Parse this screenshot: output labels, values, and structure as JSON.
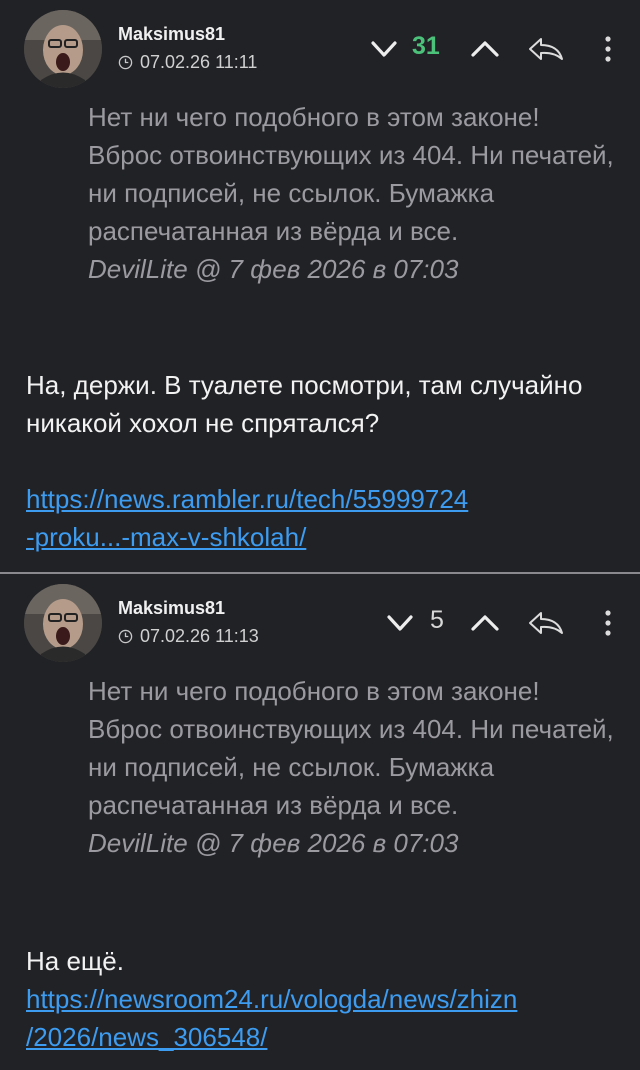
{
  "comments": [
    {
      "username": "Maksimus81",
      "datetime": "07.02.26 11:11",
      "score": "31",
      "score_color": "#4cc17a",
      "quote": {
        "text": "Нет ни чего подобного в этом законе! Вброс отвоинствующих из 404. Ни печатей, ни подписей, не ссылок. Бумажка распечатанная из вёрда и все.",
        "author": "DevilLite @ 7 фев 2026 в 07:03"
      },
      "reply_text": "На, держи. В туалете посмотри, там случайно никакой хохол не спрятался?",
      "link_line1": "https://news.rambler.ru/tech/55999724",
      "link_line2": "-proku...-max-v-shkolah/"
    },
    {
      "username": "Maksimus81",
      "datetime": "07.02.26 11:13",
      "score": "5",
      "score_color": "#d8d8d8",
      "quote": {
        "text": "Нет ни чего подобного в этом законе! Вброс отвоинствующих из 404. Ни печатей, ни подписей, не ссылок. Бумажка распечатанная из вёрда и все.",
        "author": "DevilLite @ 7 фев 2026 в 07:03"
      },
      "reply_text": "На ещё.",
      "link_line1": "https://newsroom24.ru/vologda/news/zhizn",
      "link_line2": "/2026/news_306548/"
    }
  ],
  "icons": {
    "clock": "clock-icon",
    "vote_down": "chevron-down-icon",
    "vote_up": "chevron-up-icon",
    "share": "share-arrow-icon",
    "more": "more-vertical-icon"
  },
  "colors": {
    "background": "#212226",
    "quote_text": "#9a9aa0",
    "link": "#3d9cf0",
    "divider": "#8a8a8e"
  }
}
